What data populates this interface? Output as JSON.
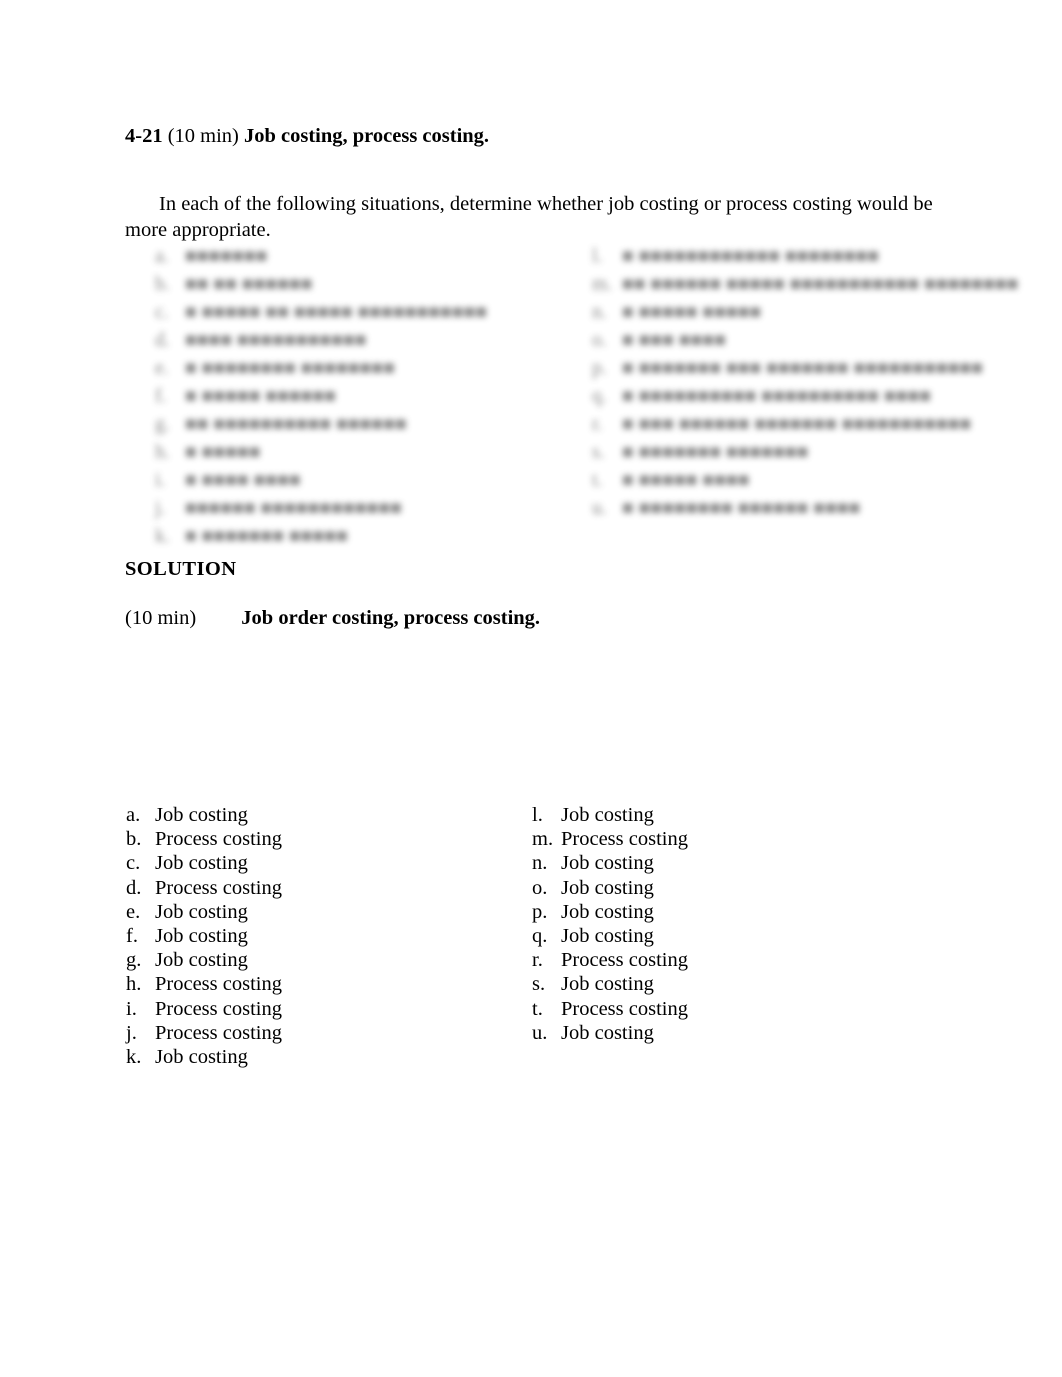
{
  "document": {
    "problem": {
      "number": "4-21",
      "time": "(10 min)",
      "title": "Job costing, process costing.",
      "intro": "In each of the following situations, determine whether job costing or process costing would be more appropriate."
    },
    "scenario_list": {
      "note": "redacted",
      "left_column": [
        {
          "marker": "a.",
          "text": "■■■■■■■"
        },
        {
          "marker": "b.",
          "text": "■■ ■■ ■■■■■■"
        },
        {
          "marker": "c.",
          "text": "■ ■■■■■ ■■ ■■■■■ ■■■■■■■■■■■"
        },
        {
          "marker": "d.",
          "text": "■■■■ ■■■■■■■■■■■"
        },
        {
          "marker": "e.",
          "text": "■ ■■■■■■■■ ■■■■■■■■"
        },
        {
          "marker": "f.",
          "text": "■ ■■■■■ ■■■■■■"
        },
        {
          "marker": "g.",
          "text": "■■ ■■■■■■■■■■ ■■■■■■"
        },
        {
          "marker": "h.",
          "text": "■ ■■■■■"
        },
        {
          "marker": "i.",
          "text": "■ ■■■■ ■■■■"
        },
        {
          "marker": "j.",
          "text": "■■■■■■ ■■■■■■■■■■■■"
        },
        {
          "marker": "k.",
          "text": "■ ■■■■■■■ ■■■■■"
        }
      ],
      "right_column": [
        {
          "marker": "l.",
          "text": "■ ■■■■■■■■■■■■ ■■■■■■■■"
        },
        {
          "marker": "m.",
          "text": "■■ ■■■■■■ ■■■■■ ■■■■■■■■■■■ ■■■■■■■■"
        },
        {
          "marker": "n.",
          "text": "■ ■■■■■ ■■■■■"
        },
        {
          "marker": "o.",
          "text": "■ ■■■ ■■■■"
        },
        {
          "marker": "p.",
          "text": "■ ■■■■■■■ ■■■ ■■■■■■■ ■■■■■■■■■■■"
        },
        {
          "marker": "q.",
          "text": "■ ■■■■■■■■■■ ■■■■■■■■■■ ■■■■"
        },
        {
          "marker": "r.",
          "text": "■ ■■■ ■■■■■■ ■■■■■■■ ■■■■■■■■■■■"
        },
        {
          "marker": "s.",
          "text": "■ ■■■■■■■ ■■■■■■■"
        },
        {
          "marker": "t.",
          "text": "■ ■■■■■ ■■■■"
        },
        {
          "marker": "u.",
          "text": "■ ■■■■■■■■ ■■■■■■ ■■■■"
        }
      ]
    },
    "solution": {
      "heading": "SOLUTION",
      "time": "(10 min)",
      "title": "Job order costing, process costing.",
      "answers_left": [
        {
          "marker": "a.",
          "value": "Job costing"
        },
        {
          "marker": "b.",
          "value": "Process costing"
        },
        {
          "marker": "c.",
          "value": "Job costing"
        },
        {
          "marker": "d.",
          "value": "Process costing"
        },
        {
          "marker": "e.",
          "value": "Job costing"
        },
        {
          "marker": "f.",
          "value": "Job costing"
        },
        {
          "marker": "g.",
          "value": "Job costing"
        },
        {
          "marker": "h.",
          "value": "Process costing"
        },
        {
          "marker": "i.",
          "value": "Process costing"
        },
        {
          "marker": "j.",
          "value": "Process costing"
        },
        {
          "marker": "k.",
          "value": "Job costing"
        }
      ],
      "answers_right": [
        {
          "marker": "l.",
          "value": "Job costing"
        },
        {
          "marker": "m.",
          "value": "Process costing"
        },
        {
          "marker": "n.",
          "value": "Job costing"
        },
        {
          "marker": "o.",
          "value": "Job costing"
        },
        {
          "marker": "p.",
          "value": "Job costing"
        },
        {
          "marker": "q.",
          "value": "Job costing"
        },
        {
          "marker": "r.",
          "value": "Process costing"
        },
        {
          "marker": "s.",
          "value": "Job costing"
        },
        {
          "marker": "t.",
          "value": "Process costing"
        },
        {
          "marker": "u.",
          "value": "Job costing"
        }
      ]
    }
  }
}
